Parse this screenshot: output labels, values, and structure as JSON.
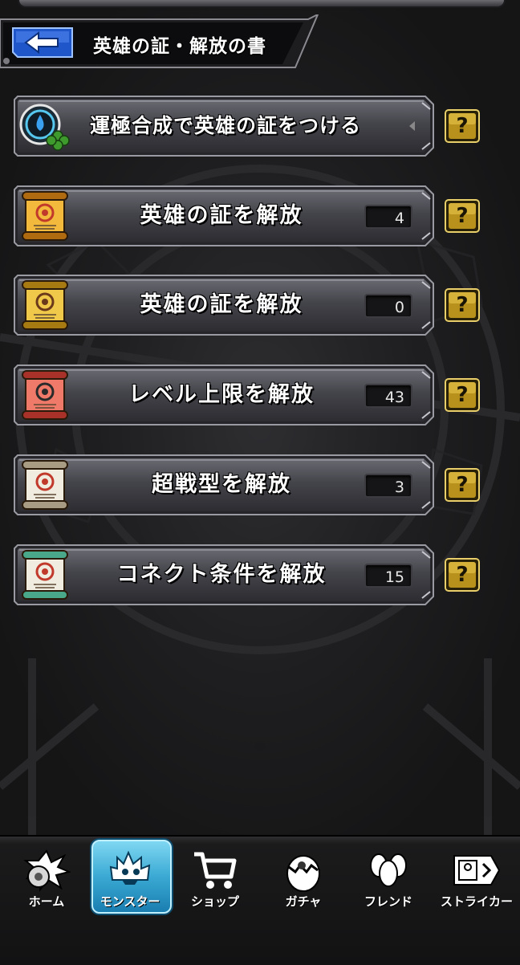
{
  "header": {
    "back_icon": "back-arrow-icon",
    "title": "英雄の証・解放の書"
  },
  "rows": [
    {
      "icon": "luck-fusion-badge-icon",
      "label": "運極合成で英雄の証をつける",
      "count": null
    },
    {
      "icon": "gold-scroll-icon",
      "label": "英雄の証を解放",
      "count": "4"
    },
    {
      "icon": "gold-scroll-skull-icon",
      "label": "英雄の証を解放",
      "count": "0"
    },
    {
      "icon": "red-scroll-icon",
      "label": "レベル上限を解放",
      "count": "43"
    },
    {
      "icon": "white-scroll-icon",
      "label": "超戦型を解放",
      "count": "3"
    },
    {
      "icon": "green-scroll-icon",
      "label": "コネクト条件を解放",
      "count": "15"
    }
  ],
  "help_label": "?",
  "nav": [
    {
      "label": "ホーム",
      "icon": "home-icon",
      "active": false
    },
    {
      "label": "モンスター",
      "icon": "monster-icon",
      "active": true
    },
    {
      "label": "ショップ",
      "icon": "cart-icon",
      "active": false
    },
    {
      "label": "ガチャ",
      "icon": "egg-icon",
      "active": false
    },
    {
      "label": "フレンド",
      "icon": "friends-icon",
      "active": false
    },
    {
      "label": "ストライカー",
      "icon": "striker-card-icon",
      "active": false
    }
  ],
  "colors": {
    "accent_blue": "#3aa9d3",
    "help_gold": "#c9a227",
    "plate_dark": "#3a3a40"
  }
}
